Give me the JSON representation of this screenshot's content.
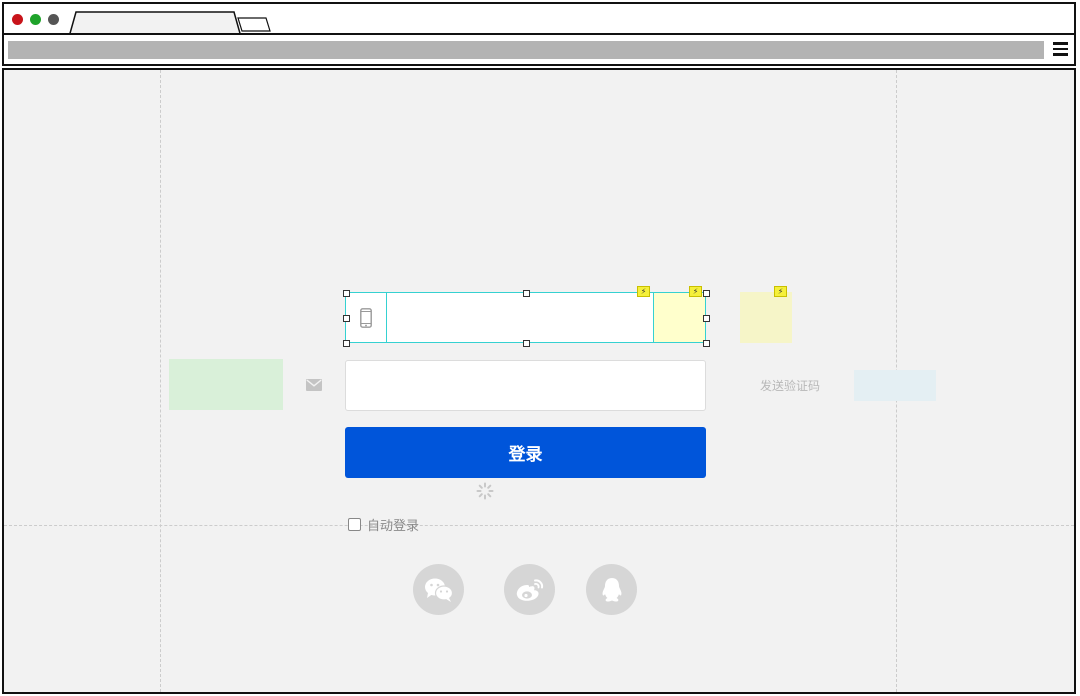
{
  "browser": {
    "tab_label": "",
    "url": ""
  },
  "form": {
    "phone_value": "",
    "email_value": "",
    "send_code_label": "发送验证码",
    "login_label": "登录",
    "auto_login_label": "自动登录"
  },
  "icons": {
    "phone": "mobile-phone-icon",
    "email": "envelope-icon",
    "loading": "spinner-icon",
    "wechat": "wechat-icon",
    "weibo": "weibo-icon",
    "qq": "qq-icon"
  },
  "colors": {
    "primary": "#0055da",
    "selection": "#35d1d1",
    "canvas": "#f2f2f2",
    "green_block": "#d9f0d9",
    "blue_block": "#e4eff3",
    "yellow_block": "#f6f5c8",
    "social_bg": "#d6d6d6"
  }
}
